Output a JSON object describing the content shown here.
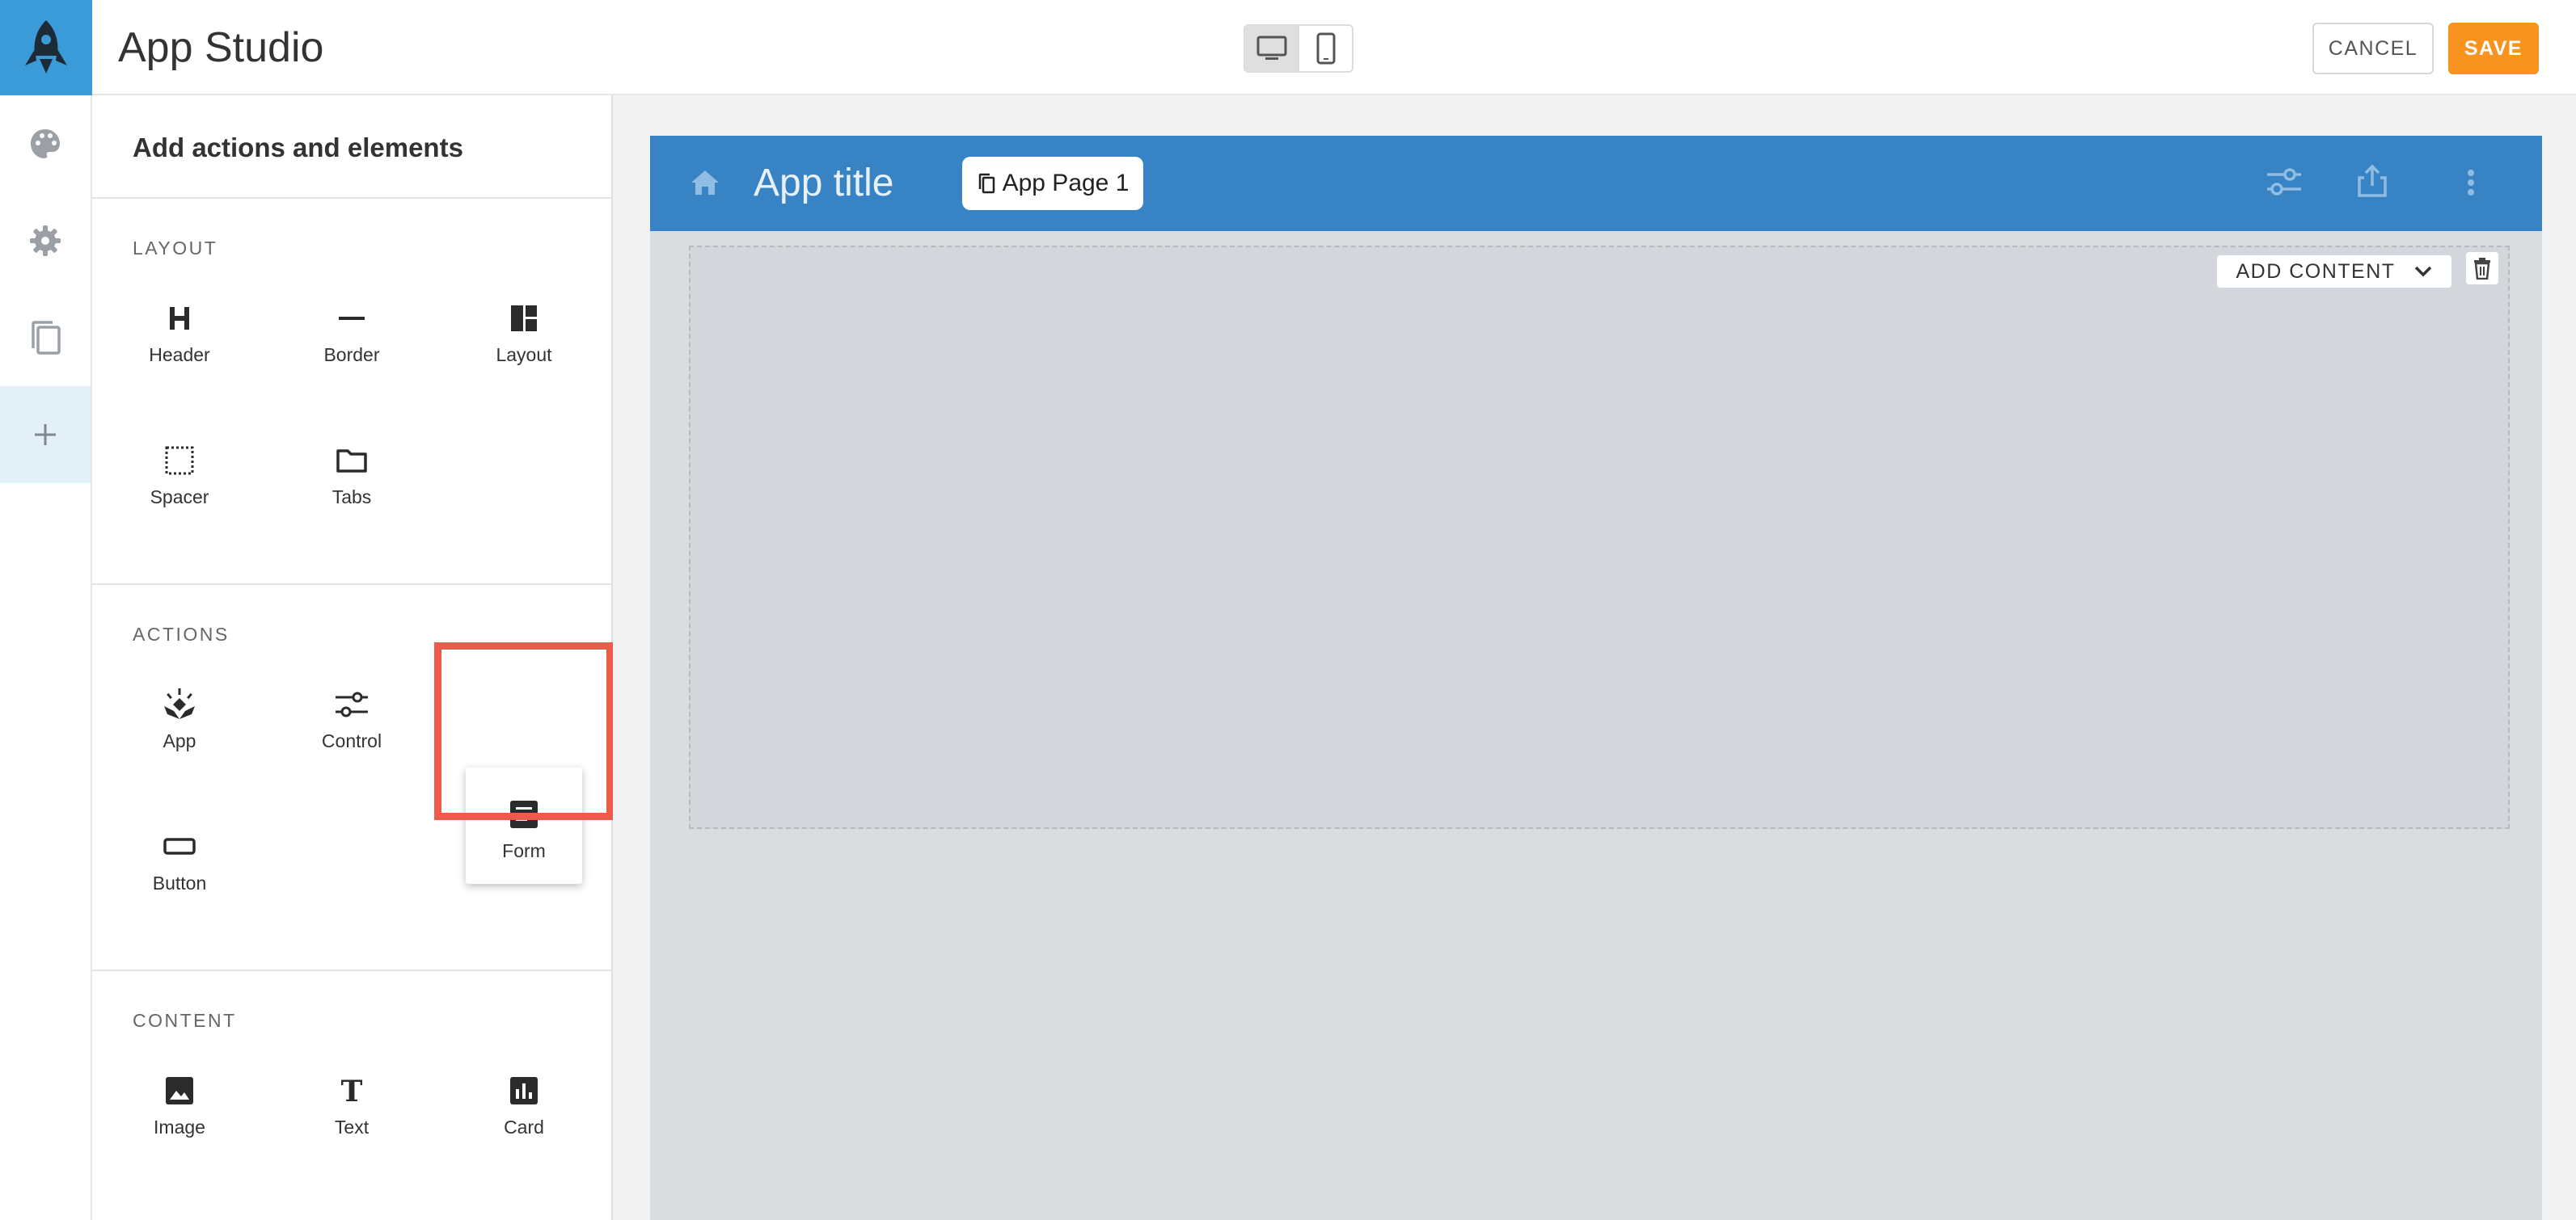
{
  "app": {
    "name": "App Studio"
  },
  "toolbar": {
    "cancel_label": "CANCEL",
    "save_label": "SAVE",
    "devices": [
      "desktop-icon",
      "mobile-icon"
    ],
    "active_device": "desktop"
  },
  "rail": {
    "items": [
      {
        "icon": "palette-icon"
      },
      {
        "icon": "gear-icon"
      },
      {
        "icon": "copy-pages-icon"
      },
      {
        "icon": "plus-icon",
        "active": true
      }
    ]
  },
  "panel": {
    "title": "Add actions and elements",
    "sections": [
      {
        "label": "LAYOUT",
        "items": [
          {
            "label": "Header",
            "icon": "header-icon"
          },
          {
            "label": "Border",
            "icon": "border-icon"
          },
          {
            "label": "Layout",
            "icon": "layout-icon"
          },
          {
            "label": "Spacer",
            "icon": "spacer-icon"
          },
          {
            "label": "Tabs",
            "icon": "folder-icon"
          }
        ]
      },
      {
        "label": "ACTIONS",
        "items": [
          {
            "label": "App",
            "icon": "app-icon"
          },
          {
            "label": "Control",
            "icon": "sliders-icon"
          },
          {
            "label": "Form",
            "icon": "form-icon",
            "highlighted": true
          },
          {
            "label": "Button",
            "icon": "button-icon"
          }
        ]
      },
      {
        "label": "CONTENT",
        "items": [
          {
            "label": "Image",
            "icon": "image-icon"
          },
          {
            "label": "Text",
            "icon": "text-icon"
          },
          {
            "label": "Card",
            "icon": "chart-card-icon"
          }
        ]
      }
    ]
  },
  "preview": {
    "app_title": "App title",
    "page_chip": "App Page 1",
    "add_content_label": "ADD CONTENT",
    "header_color": "#3783c4",
    "header_icons": [
      "sliders-icon",
      "share-icon",
      "more-vert-icon"
    ]
  },
  "colors": {
    "accent_blue": "#3b9bd8",
    "save_orange": "#f7931e",
    "highlight_red": "#f05a4b"
  }
}
